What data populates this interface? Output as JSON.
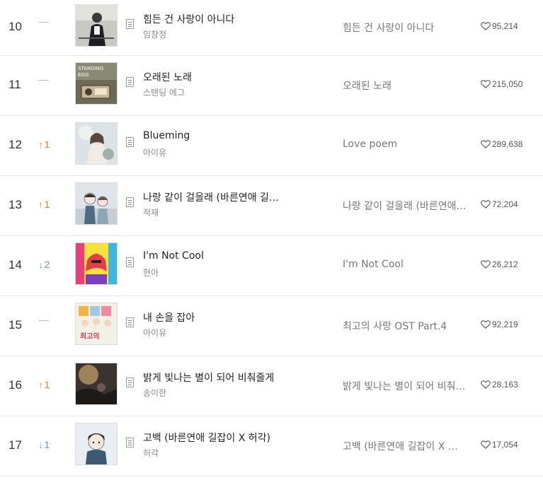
{
  "rows": [
    {
      "rank": "10",
      "change": {
        "dir": "same",
        "amount": ""
      },
      "title": "힘든 건 사랑이 아니다",
      "artist": "임창정",
      "album": "힘든 건 사랑이 아니다",
      "likes": "95,214",
      "cover": "cover-limchangjung"
    },
    {
      "rank": "11",
      "change": {
        "dir": "same",
        "amount": ""
      },
      "title": "오래된 노래",
      "artist": "스탠딩 에그",
      "album": "오래된 노래",
      "likes": "215,050",
      "cover": "cover-standing-egg",
      "cover_text": "STANDING EGG"
    },
    {
      "rank": "12",
      "change": {
        "dir": "up",
        "amount": "1"
      },
      "title": "Blueming",
      "artist": "아이유",
      "album": "Love poem",
      "likes": "289,638",
      "cover": "cover-love-poem"
    },
    {
      "rank": "13",
      "change": {
        "dir": "up",
        "amount": "1"
      },
      "title": "나랑 같이 걸을래 (바른연애 길잡이 X 적재)",
      "artist": "적재",
      "album": "나랑 같이 걸을래 (바른연애 길잡이 X 적재)",
      "likes": "72,204",
      "cover": "cover-webtoon-walk"
    },
    {
      "rank": "14",
      "change": {
        "dir": "down",
        "amount": "2"
      },
      "title": "I'm Not Cool",
      "artist": "현아",
      "album": "I'm Not Cool",
      "likes": "26,212",
      "cover": "cover-hyuna"
    },
    {
      "rank": "15",
      "change": {
        "dir": "same",
        "amount": ""
      },
      "title": "내 손을 잡아",
      "artist": "아이유",
      "album": "최고의 사랑 OST Part.4",
      "likes": "92,219",
      "cover": "cover-best-love-ost"
    },
    {
      "rank": "16",
      "change": {
        "dir": "up",
        "amount": "1"
      },
      "title": "밝게 빛나는 별이 되어 비춰줄게",
      "artist": "송이한",
      "album": "밝게 빛나는 별이 되어 비춰줄게",
      "likes": "28,163",
      "cover": "cover-song-ihan"
    },
    {
      "rank": "17",
      "change": {
        "dir": "down",
        "amount": "1"
      },
      "title": "고백 (바른연애 길잡이 X 허각)",
      "artist": "허각",
      "album": "고백 (바른연애 길잡이 X 허각)",
      "likes": "17,054",
      "cover": "cover-webtoon-confess"
    }
  ],
  "icons": {
    "up": "up-arrow-icon",
    "down": "down-arrow-icon",
    "same": "no-change-dash-icon",
    "lyrics": "lyrics-document-icon",
    "like": "heart-icon"
  },
  "colors": {
    "up": "#e67e22",
    "down": "#5b9bd5",
    "divider": "#e6e6e6"
  }
}
